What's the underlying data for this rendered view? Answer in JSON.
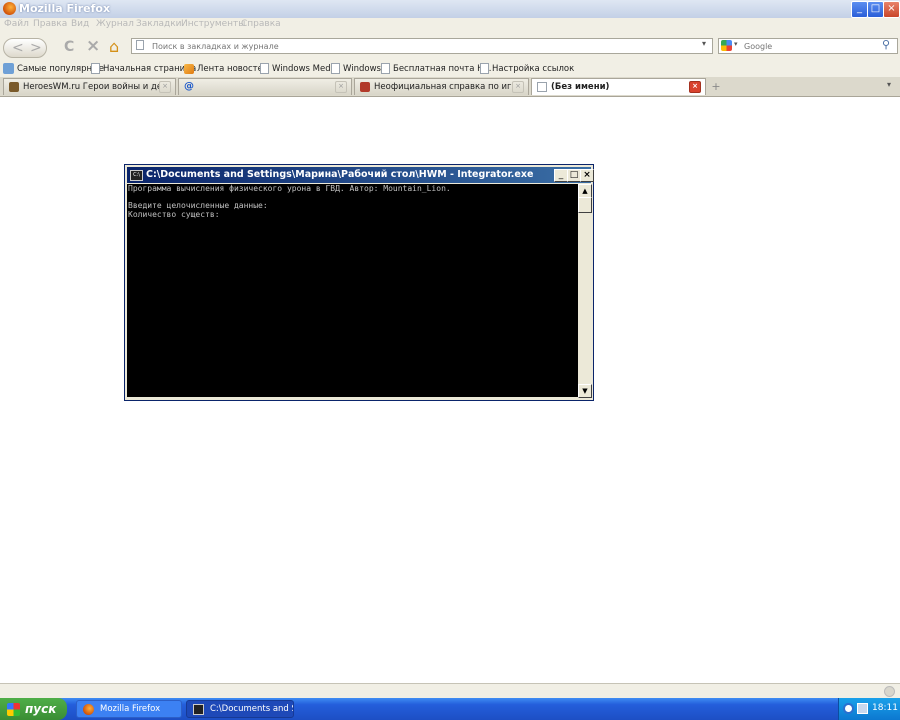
{
  "window": {
    "title": "Mozilla Firefox",
    "min": "_",
    "max": "□",
    "close": "×"
  },
  "menu": [
    "Файл",
    "Правка",
    "Вид",
    "Журнал",
    "Закладки",
    "Инструменты",
    "Справка"
  ],
  "nav": {
    "back": "<",
    "forward": ">",
    "reload": "C",
    "stop": "×",
    "home": "⌂",
    "url_placeholder": "Поиск в закладках и журнале",
    "search_engine": "Google"
  },
  "bookmarks": [
    "Самые популярные",
    "Начальная страница",
    "Лента новостей",
    "Windows Media",
    "Windows",
    "Бесплатная почта H...",
    "Настройка ссылок"
  ],
  "tabs": [
    {
      "label": "HeroesWM.ru Герои войны и денег. ...",
      "active": false
    },
    {
      "label": "@",
      "active": false
    },
    {
      "label": "Неофициальная справка по игре Her...",
      "active": false
    },
    {
      "label": "(Без имени)",
      "active": true
    }
  ],
  "new_tab": "+",
  "console": {
    "title": "C:\\Documents and Settings\\Марина\\Рабочий стол\\HWM - Integrator.exe",
    "icon": "C:\\",
    "lines": [
      "Программа вычисления физического урона в ГВД. Автор: Mountain_Lion.",
      "",
      "Введите целочисленные данные:",
      "Количество существ:"
    ]
  },
  "taskbar": {
    "start": "пуск",
    "items": [
      {
        "label": "Mozilla Firefox"
      },
      {
        "label": "C:\\Documents and Se..."
      }
    ],
    "clock": "18:11"
  }
}
